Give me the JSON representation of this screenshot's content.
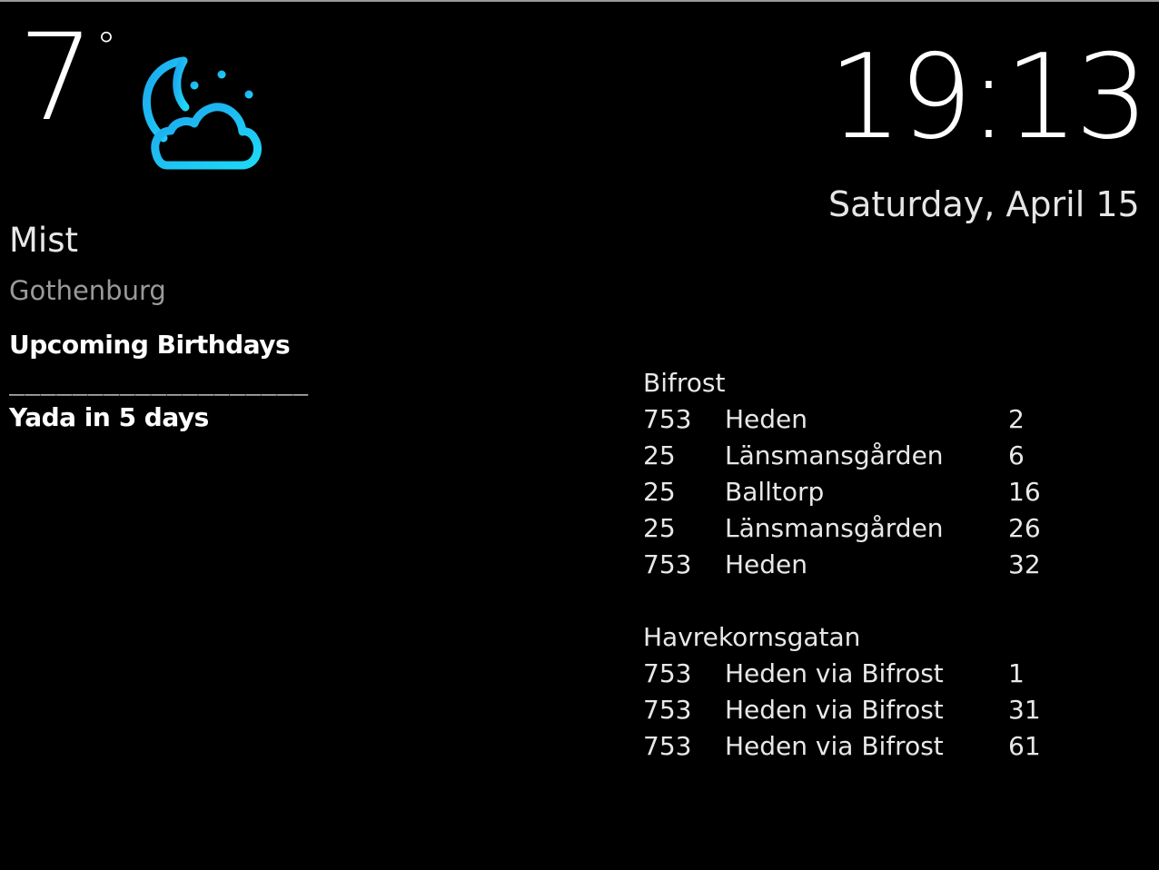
{
  "weather": {
    "temperature": "7",
    "degree_symbol": "°",
    "icon": "night-cloudy-icon",
    "condition": "Mist",
    "location": "Gothenburg"
  },
  "clock": {
    "time": "19:13",
    "date": "Saturday, April 15"
  },
  "birthdays": {
    "title": "Upcoming Birthdays",
    "separator": "___________________",
    "items": [
      "Yada in 5 days"
    ]
  },
  "departures": [
    {
      "stop": "Bifrost",
      "rows": [
        {
          "line": "753",
          "destination": "Heden",
          "minutes": "2"
        },
        {
          "line": "25",
          "destination": "Länsmansgården",
          "minutes": "6"
        },
        {
          "line": "25",
          "destination": "Balltorp",
          "minutes": "16"
        },
        {
          "line": "25",
          "destination": "Länsmansgården",
          "minutes": "26"
        },
        {
          "line": "753",
          "destination": "Heden",
          "minutes": "32"
        }
      ]
    },
    {
      "stop": "Havrekornsgatan",
      "rows": [
        {
          "line": "753",
          "destination": "Heden via Bifrost",
          "minutes": "1"
        },
        {
          "line": "753",
          "destination": "Heden via Bifrost",
          "minutes": "31"
        },
        {
          "line": "753",
          "destination": "Heden via Bifrost",
          "minutes": "61"
        }
      ]
    }
  ],
  "colors": {
    "background": "#000000",
    "text": "#ffffff",
    "dim_text": "#9a9a9a",
    "icon_gradient_top": "#1fb4ee",
    "icon_gradient_bottom": "#1ed8f5"
  }
}
